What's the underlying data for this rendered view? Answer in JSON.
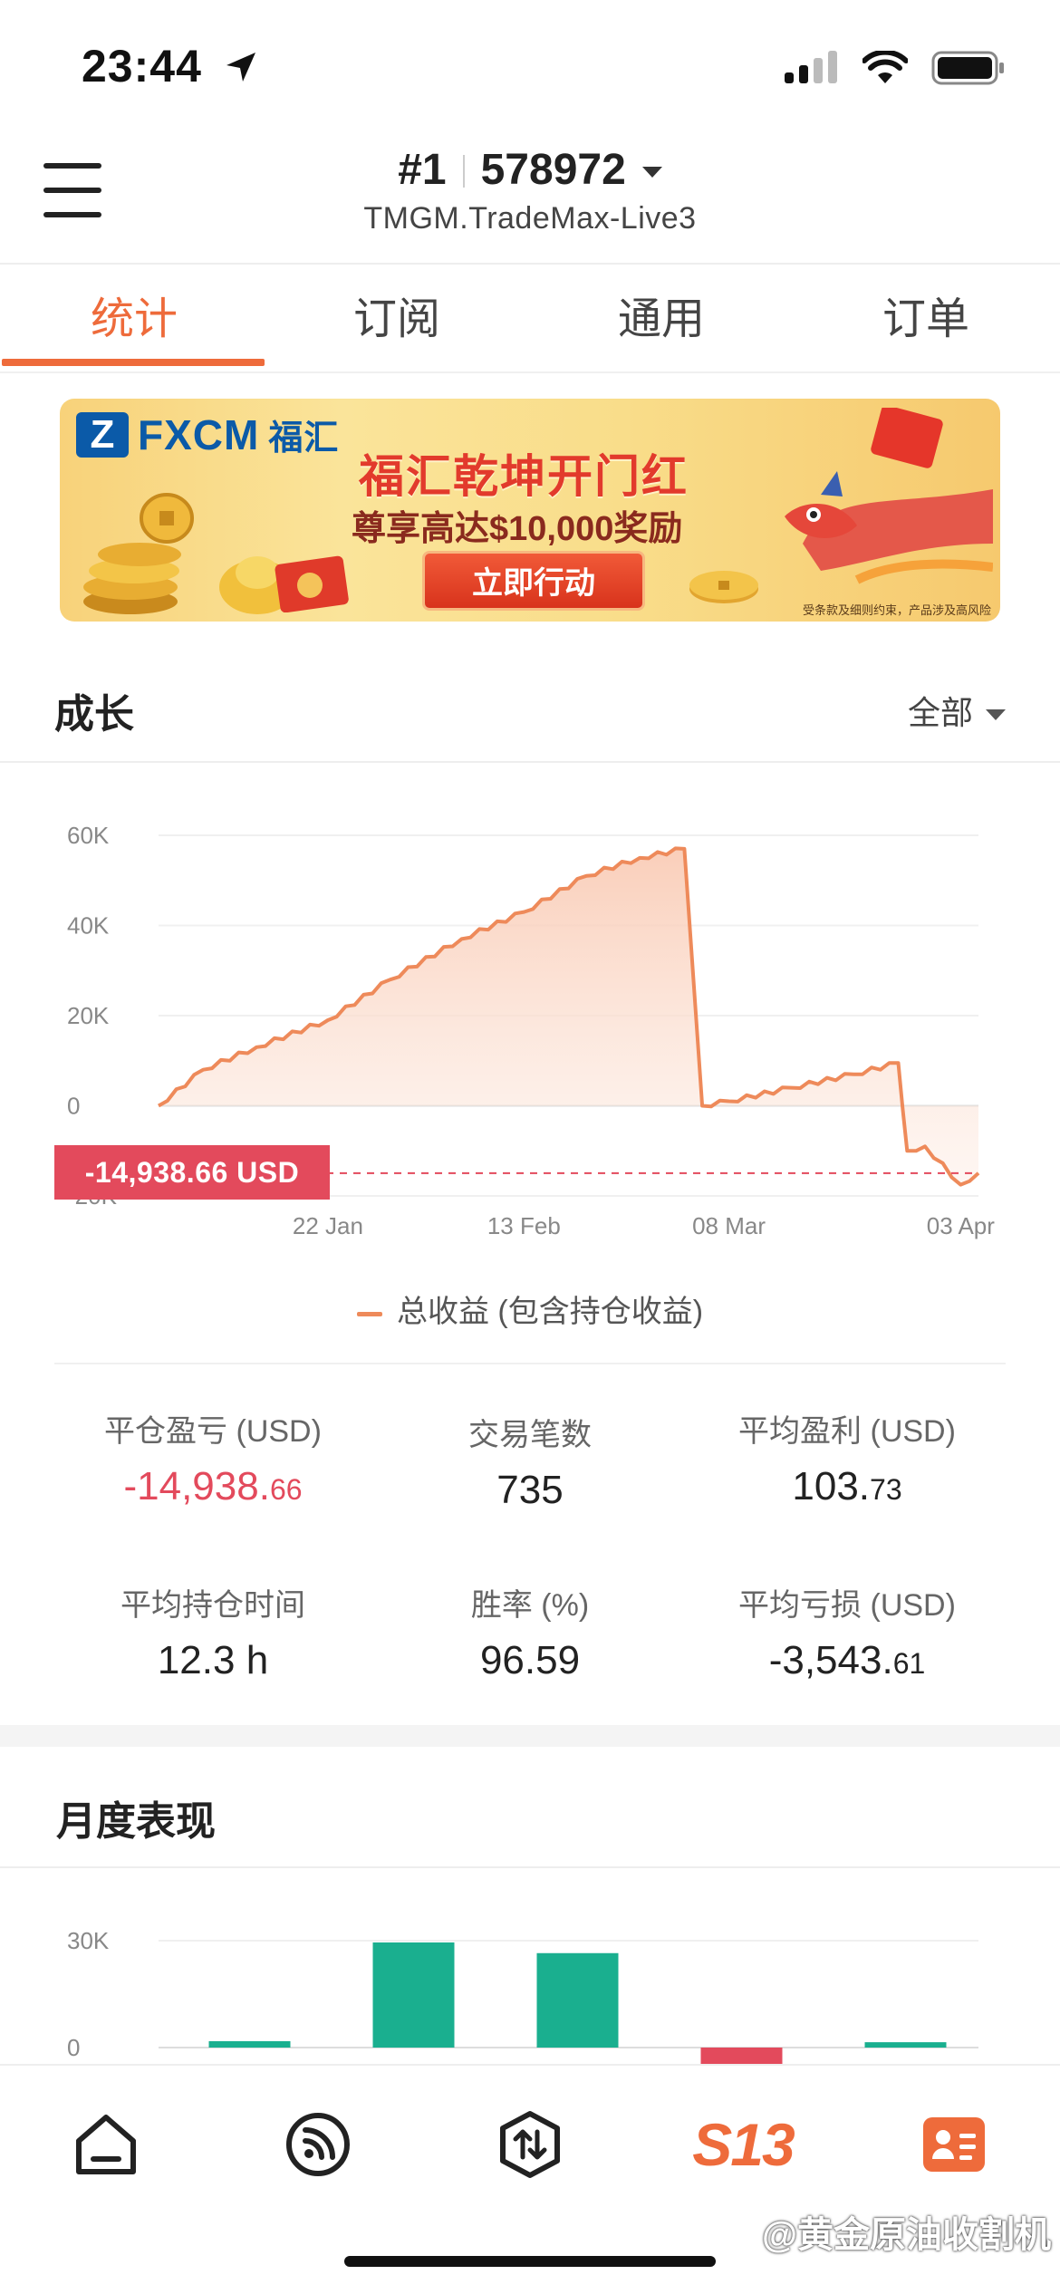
{
  "status_bar": {
    "time": "23:44"
  },
  "header": {
    "rank": "#1",
    "account": "578972",
    "server": "TMGM.TradeMax-Live3"
  },
  "tabs": [
    {
      "label": "统计",
      "active": true
    },
    {
      "label": "订阅",
      "active": false
    },
    {
      "label": "通用",
      "active": false
    },
    {
      "label": "订单",
      "active": false
    }
  ],
  "banner": {
    "brand": "FXCM",
    "brand_cn": "福汇",
    "title": "福汇乾坤开门红",
    "subtitle": "尊享高达$10,000奖励",
    "cta": "立即行动",
    "fine_print": "受条款及细则约束，产品涉及高风险"
  },
  "growth": {
    "title": "成长",
    "filter": "全部",
    "pnl_tag": "-14,938.66 USD",
    "legend": "总收益 (包含持仓收益)"
  },
  "chart_data": [
    {
      "type": "area",
      "title": "",
      "ylabel": "",
      "xlabel": "",
      "y_ticks": [
        "60K",
        "40K",
        "20K",
        "0",
        "-20K"
      ],
      "x_ticks": [
        "22 Jan",
        "13 Feb",
        "08 Mar",
        "03 Apr"
      ],
      "ylim": [
        -20000,
        60000
      ],
      "series": [
        {
          "name": "总收益 (包含持仓收益)",
          "x": [
            "03 Jan",
            "08 Jan",
            "14 Jan",
            "22 Jan",
            "29 Jan",
            "06 Feb",
            "13 Feb",
            "20 Feb",
            "26 Feb",
            "03 Mar",
            "05 Mar",
            "08 Mar",
            "15 Mar",
            "22 Mar",
            "27 Mar",
            "28 Mar",
            "30 Mar",
            "03 Apr",
            "05 Apr"
          ],
          "values": [
            0,
            8000,
            13000,
            19000,
            28000,
            37000,
            43000,
            51000,
            55000,
            57000,
            0,
            1000,
            4000,
            7000,
            9500,
            -10000,
            -9000,
            -17500,
            -14938.66
          ]
        }
      ],
      "reference_line": -14938.66
    },
    {
      "type": "bar",
      "title": "月度表现",
      "y_ticks": [
        "30K",
        "0"
      ],
      "ylim": [
        -5000,
        30000
      ],
      "series": [
        {
          "values": [
            1800,
            29500,
            26500,
            -5000,
            1500
          ]
        }
      ]
    }
  ],
  "stats": [
    {
      "label": "平仓盈亏 (USD)",
      "value_main": "-14,938.",
      "value_dec": "66",
      "negative": true
    },
    {
      "label": "交易笔数",
      "value_main": "735",
      "value_dec": "",
      "negative": false
    },
    {
      "label": "平均盈利 (USD)",
      "value_main": "103.",
      "value_dec": "73",
      "negative": false
    },
    {
      "label": "平均持仓时间",
      "value_main": "12.3 h",
      "value_dec": "",
      "negative": false
    },
    {
      "label": "胜率 (%)",
      "value_main": "96.59",
      "value_dec": "",
      "negative": false
    },
    {
      "label": "平均亏损 (USD)",
      "value_main": "-3,543.",
      "value_dec": "61",
      "negative": false
    }
  ],
  "monthly": {
    "title": "月度表现"
  },
  "bottom_nav": [
    {
      "icon": "home-icon"
    },
    {
      "icon": "signal-feed-icon"
    },
    {
      "icon": "trade-exchange-icon"
    },
    {
      "icon": "s13-logo",
      "label": "S13"
    },
    {
      "icon": "profile-card-icon"
    }
  ],
  "watermark": "@黄金原油收割机",
  "colors": {
    "accent": "#ee6b3b",
    "negative": "#e34a5c",
    "positive_bar": "#1aaf8f",
    "line": "#ee8a5a"
  }
}
